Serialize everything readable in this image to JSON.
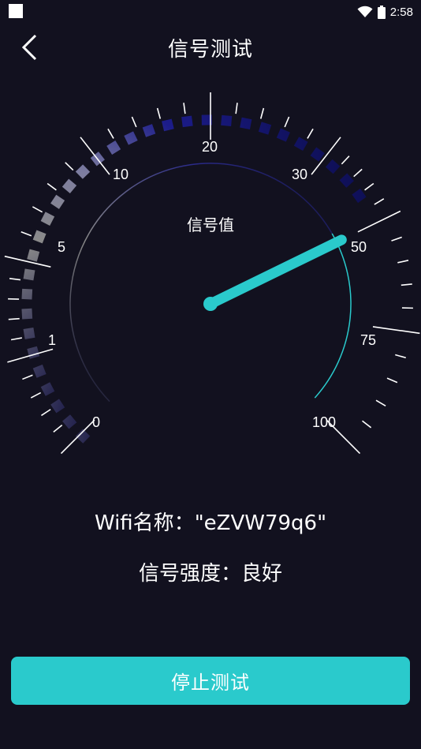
{
  "status_bar": {
    "time": "2:58",
    "icons": [
      "notification-square-icon",
      "wifi-icon",
      "battery-icon"
    ]
  },
  "header": {
    "back_icon": "chevron-left-icon",
    "title": "信号测试"
  },
  "gauge": {
    "center_label": "信号值",
    "scale_labels": [
      "0",
      "1",
      "5",
      "10",
      "20",
      "30",
      "50",
      "75",
      "100"
    ],
    "needle_value": 50,
    "accent_color": "#2acacc"
  },
  "info": {
    "wifi_label": "Wifi名称：",
    "wifi_name": "\"eZVW79q6\"",
    "strength_label": "信号强度：",
    "strength_value": "良好"
  },
  "actions": {
    "stop_label": "停止测试"
  },
  "colors": {
    "background": "#12111f",
    "accent": "#2acacc"
  }
}
